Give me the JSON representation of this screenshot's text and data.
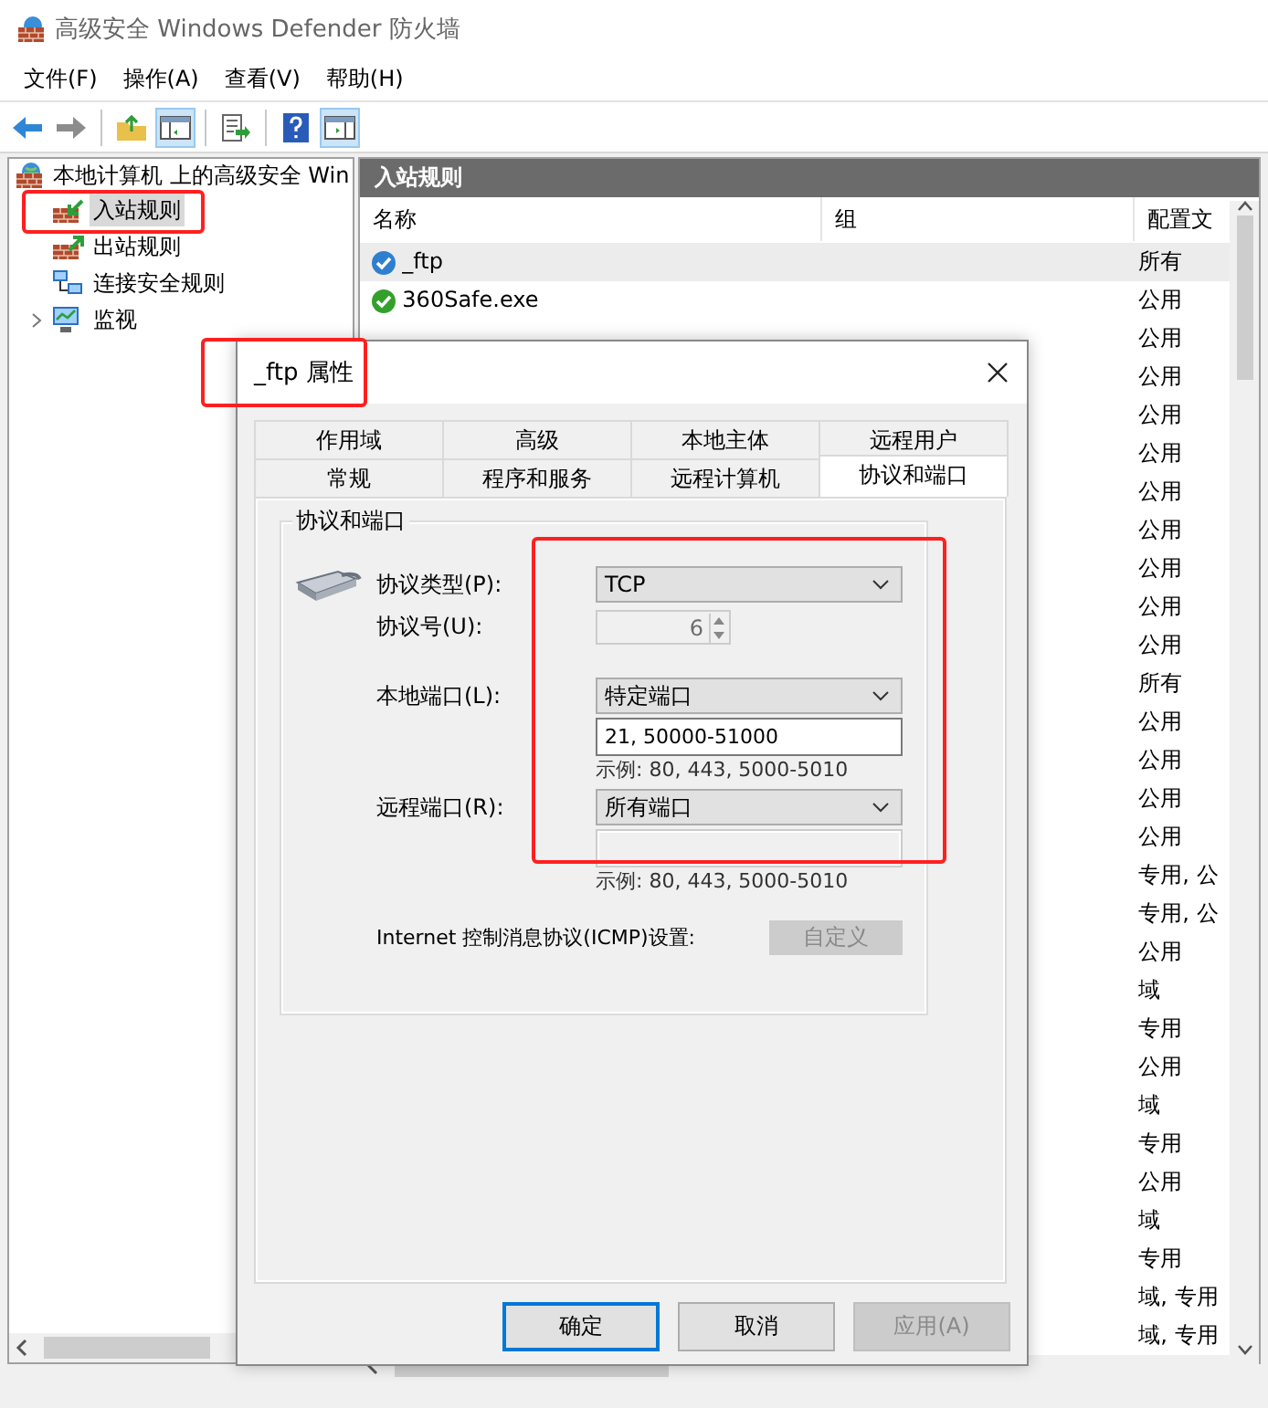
{
  "window": {
    "title": "高级安全 Windows Defender 防火墙"
  },
  "menu": [
    "文件(F)",
    "操作(A)",
    "查看(V)",
    "帮助(H)"
  ],
  "toolbar": [
    [
      {
        "kind": "back",
        "pressed": false
      },
      {
        "kind": "forward",
        "pressed": false
      }
    ],
    [
      {
        "kind": "folder-up",
        "pressed": false
      },
      {
        "kind": "tree-pane",
        "pressed": true
      }
    ],
    [
      {
        "kind": "export",
        "pressed": false
      }
    ],
    [
      {
        "kind": "help",
        "pressed": false
      },
      {
        "kind": "action-pane",
        "pressed": true
      }
    ]
  ],
  "tree": {
    "label": "本地计算机 上的高级安全 Win",
    "kind": "firewall",
    "children": [
      {
        "label": "入站规则",
        "kind": "inbound",
        "selected": true
      },
      {
        "label": "出站规则",
        "kind": "outbound",
        "selected": false
      },
      {
        "label": "连接安全规则",
        "kind": "connection",
        "selected": false
      },
      {
        "label": "监视",
        "kind": "monitor",
        "selected": false,
        "expanded": false
      }
    ]
  },
  "rules": {
    "title": "入站规则",
    "columns": [
      "名称",
      "组",
      "配置文"
    ],
    "rows": [
      {
        "name": "_ftp",
        "color": "#2f7fd0",
        "profile": "所有",
        "selected": true
      },
      {
        "name": "360Safe.exe",
        "color": "#33a02c",
        "profile": "公用",
        "selected": false
      },
      {
        "profile": "公用"
      },
      {
        "profile": "公用"
      },
      {
        "profile": "公用"
      },
      {
        "profile": "公用"
      },
      {
        "profile": "公用"
      },
      {
        "profile": "公用"
      },
      {
        "profile": "公用"
      },
      {
        "profile": "公用"
      },
      {
        "profile": "公用"
      },
      {
        "profile": "所有"
      },
      {
        "profile": "公用"
      },
      {
        "profile": "公用"
      },
      {
        "profile": "公用"
      },
      {
        "profile": "公用"
      },
      {
        "profile": "专用, 公"
      },
      {
        "profile": "专用, 公"
      },
      {
        "profile": "公用"
      },
      {
        "profile": "域"
      },
      {
        "profile": "专用"
      },
      {
        "profile": "公用"
      },
      {
        "profile": "域"
      },
      {
        "profile": "专用"
      },
      {
        "profile": "公用"
      },
      {
        "profile": "域"
      },
      {
        "profile": "专用"
      },
      {
        "profile": "域, 专用"
      },
      {
        "profile": "域, 专用"
      }
    ]
  },
  "dialog": {
    "title": "_ftp 属性",
    "tabs": [
      [
        {
          "label": "作用域",
          "selected": false
        },
        {
          "label": "高级",
          "selected": false
        },
        {
          "label": "本地主体",
          "selected": false
        },
        {
          "label": "远程用户",
          "selected": false
        }
      ],
      [
        {
          "label": "常规",
          "selected": false
        },
        {
          "label": "程序和服务",
          "selected": false
        },
        {
          "label": "远程计算机",
          "selected": false
        },
        {
          "label": "协议和端口",
          "selected": true
        }
      ]
    ],
    "group_title": "协议和端口",
    "protocol_type": {
      "label": "协议类型(P):",
      "value": "TCP"
    },
    "protocol_number": {
      "label": "协议号(U):",
      "value": "6",
      "disabled": true
    },
    "local_port": {
      "label": "本地端口(L):",
      "value": "特定端口",
      "ports": "21, 50000-51000",
      "ports_disabled": false,
      "hint": "示例: 80, 443, 5000-5010"
    },
    "remote_port": {
      "label": "远程端口(R):",
      "value": "所有端口",
      "ports_disabled": true,
      "hint": "示例: 80, 443, 5000-5010"
    },
    "icmp": {
      "label": "Internet 控制消息协议(ICMP)设置:",
      "button": "自定义",
      "disabled": true
    },
    "buttons": [
      {
        "label": "确定",
        "default": true,
        "disabled": false
      },
      {
        "label": "取消",
        "default": false,
        "disabled": false
      },
      {
        "label": "应用(A)",
        "default": false,
        "disabled": true
      }
    ]
  }
}
